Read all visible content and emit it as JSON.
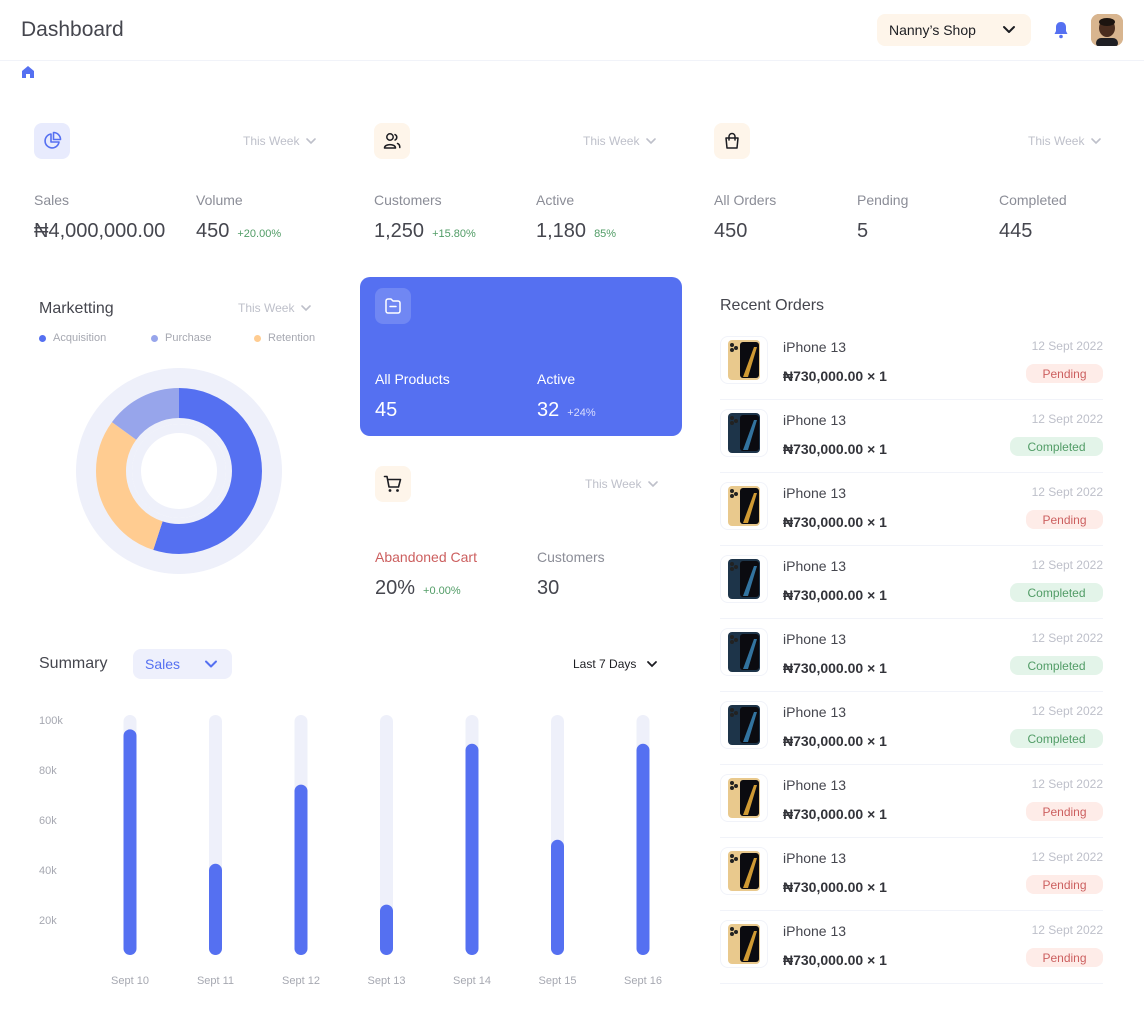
{
  "header": {
    "title": "Dashboard",
    "shop_name": "Nanny’s Shop"
  },
  "colors": {
    "accent": "#5570f1",
    "accent_light": "#97a5eb",
    "orange": "#ffcc91",
    "track": "#eef0fa",
    "positive": "#519c66",
    "negative": "#cc5f5f"
  },
  "sales_card": {
    "period": "This Week",
    "sales_label": "Sales",
    "sales_value": "₦4,000,000.00",
    "volume_label": "Volume",
    "volume_value": "450",
    "volume_change": "+20.00%"
  },
  "customers_card": {
    "period": "This Week",
    "customers_label": "Customers",
    "customers_value": "1,250",
    "customers_change": "+15.80%",
    "active_label": "Active",
    "active_value": "1,180",
    "active_change": "85%"
  },
  "orders_card": {
    "period": "This Week",
    "all_label": "All Orders",
    "all_value": "450",
    "pending_label": "Pending",
    "pending_value": "5",
    "completed_label": "Completed",
    "completed_value": "445"
  },
  "marketing": {
    "title": "Marketting",
    "period": "This Week",
    "legend": [
      "Acquisition",
      "Purchase",
      "Retention"
    ],
    "shares": [
      0.55,
      0.3,
      0.15
    ]
  },
  "products_card": {
    "all_label": "All Products",
    "all_value": "45",
    "active_label": "Active",
    "active_value": "32",
    "active_change": "+24%"
  },
  "cart_card": {
    "period": "This Week",
    "abandoned_label": "Abandoned Cart",
    "abandoned_value": "20%",
    "abandoned_change": "+0.00%",
    "customers_label": "Customers",
    "customers_value": "30"
  },
  "summary": {
    "title": "Summary",
    "metric": "Sales",
    "range": "Last 7 Days"
  },
  "chart_data": {
    "type": "bar",
    "categories": [
      "Sept 10",
      "Sept 11",
      "Sept 12",
      "Sept 13",
      "Sept 14",
      "Sept 15",
      "Sept 16"
    ],
    "values": [
      94000,
      38000,
      71000,
      21000,
      88000,
      48000,
      88000
    ],
    "yticks": [
      "100k",
      "80k",
      "60k",
      "40k",
      "20k"
    ],
    "ylim": [
      0,
      100000
    ],
    "grid": false
  },
  "recent_orders": {
    "title": "Recent Orders",
    "items": [
      {
        "name": "iPhone 13",
        "price": "₦730,000.00 × 1",
        "date": "12 Sept 2022",
        "status": "Pending",
        "variant": "gold"
      },
      {
        "name": "iPhone 13",
        "price": "₦730,000.00 × 1",
        "date": "12 Sept 2022",
        "status": "Completed",
        "variant": "blue"
      },
      {
        "name": "iPhone 13",
        "price": "₦730,000.00 × 1",
        "date": "12 Sept 2022",
        "status": "Pending",
        "variant": "gold"
      },
      {
        "name": "iPhone 13",
        "price": "₦730,000.00 × 1",
        "date": "12 Sept 2022",
        "status": "Completed",
        "variant": "blue"
      },
      {
        "name": "iPhone 13",
        "price": "₦730,000.00 × 1",
        "date": "12 Sept 2022",
        "status": "Completed",
        "variant": "blue"
      },
      {
        "name": "iPhone 13",
        "price": "₦730,000.00 × 1",
        "date": "12 Sept 2022",
        "status": "Completed",
        "variant": "blue"
      },
      {
        "name": "iPhone 13",
        "price": "₦730,000.00 × 1",
        "date": "12 Sept 2022",
        "status": "Pending",
        "variant": "gold"
      },
      {
        "name": "iPhone 13",
        "price": "₦730,000.00 × 1",
        "date": "12 Sept 2022",
        "status": "Pending",
        "variant": "gold"
      },
      {
        "name": "iPhone 13",
        "price": "₦730,000.00 × 1",
        "date": "12 Sept 2022",
        "status": "Pending",
        "variant": "gold"
      }
    ]
  }
}
